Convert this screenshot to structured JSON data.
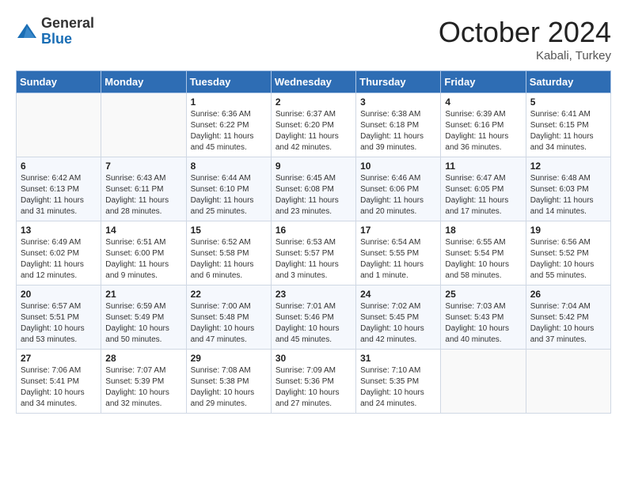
{
  "header": {
    "logo_line1": "General",
    "logo_line2": "Blue",
    "month_title": "October 2024",
    "location": "Kabali, Turkey"
  },
  "days_of_week": [
    "Sunday",
    "Monday",
    "Tuesday",
    "Wednesday",
    "Thursday",
    "Friday",
    "Saturday"
  ],
  "weeks": [
    [
      {
        "day": "",
        "content": ""
      },
      {
        "day": "",
        "content": ""
      },
      {
        "day": "1",
        "content": "Sunrise: 6:36 AM\nSunset: 6:22 PM\nDaylight: 11 hours and 45 minutes."
      },
      {
        "day": "2",
        "content": "Sunrise: 6:37 AM\nSunset: 6:20 PM\nDaylight: 11 hours and 42 minutes."
      },
      {
        "day": "3",
        "content": "Sunrise: 6:38 AM\nSunset: 6:18 PM\nDaylight: 11 hours and 39 minutes."
      },
      {
        "day": "4",
        "content": "Sunrise: 6:39 AM\nSunset: 6:16 PM\nDaylight: 11 hours and 36 minutes."
      },
      {
        "day": "5",
        "content": "Sunrise: 6:41 AM\nSunset: 6:15 PM\nDaylight: 11 hours and 34 minutes."
      }
    ],
    [
      {
        "day": "6",
        "content": "Sunrise: 6:42 AM\nSunset: 6:13 PM\nDaylight: 11 hours and 31 minutes."
      },
      {
        "day": "7",
        "content": "Sunrise: 6:43 AM\nSunset: 6:11 PM\nDaylight: 11 hours and 28 minutes."
      },
      {
        "day": "8",
        "content": "Sunrise: 6:44 AM\nSunset: 6:10 PM\nDaylight: 11 hours and 25 minutes."
      },
      {
        "day": "9",
        "content": "Sunrise: 6:45 AM\nSunset: 6:08 PM\nDaylight: 11 hours and 23 minutes."
      },
      {
        "day": "10",
        "content": "Sunrise: 6:46 AM\nSunset: 6:06 PM\nDaylight: 11 hours and 20 minutes."
      },
      {
        "day": "11",
        "content": "Sunrise: 6:47 AM\nSunset: 6:05 PM\nDaylight: 11 hours and 17 minutes."
      },
      {
        "day": "12",
        "content": "Sunrise: 6:48 AM\nSunset: 6:03 PM\nDaylight: 11 hours and 14 minutes."
      }
    ],
    [
      {
        "day": "13",
        "content": "Sunrise: 6:49 AM\nSunset: 6:02 PM\nDaylight: 11 hours and 12 minutes."
      },
      {
        "day": "14",
        "content": "Sunrise: 6:51 AM\nSunset: 6:00 PM\nDaylight: 11 hours and 9 minutes."
      },
      {
        "day": "15",
        "content": "Sunrise: 6:52 AM\nSunset: 5:58 PM\nDaylight: 11 hours and 6 minutes."
      },
      {
        "day": "16",
        "content": "Sunrise: 6:53 AM\nSunset: 5:57 PM\nDaylight: 11 hours and 3 minutes."
      },
      {
        "day": "17",
        "content": "Sunrise: 6:54 AM\nSunset: 5:55 PM\nDaylight: 11 hours and 1 minute."
      },
      {
        "day": "18",
        "content": "Sunrise: 6:55 AM\nSunset: 5:54 PM\nDaylight: 10 hours and 58 minutes."
      },
      {
        "day": "19",
        "content": "Sunrise: 6:56 AM\nSunset: 5:52 PM\nDaylight: 10 hours and 55 minutes."
      }
    ],
    [
      {
        "day": "20",
        "content": "Sunrise: 6:57 AM\nSunset: 5:51 PM\nDaylight: 10 hours and 53 minutes."
      },
      {
        "day": "21",
        "content": "Sunrise: 6:59 AM\nSunset: 5:49 PM\nDaylight: 10 hours and 50 minutes."
      },
      {
        "day": "22",
        "content": "Sunrise: 7:00 AM\nSunset: 5:48 PM\nDaylight: 10 hours and 47 minutes."
      },
      {
        "day": "23",
        "content": "Sunrise: 7:01 AM\nSunset: 5:46 PM\nDaylight: 10 hours and 45 minutes."
      },
      {
        "day": "24",
        "content": "Sunrise: 7:02 AM\nSunset: 5:45 PM\nDaylight: 10 hours and 42 minutes."
      },
      {
        "day": "25",
        "content": "Sunrise: 7:03 AM\nSunset: 5:43 PM\nDaylight: 10 hours and 40 minutes."
      },
      {
        "day": "26",
        "content": "Sunrise: 7:04 AM\nSunset: 5:42 PM\nDaylight: 10 hours and 37 minutes."
      }
    ],
    [
      {
        "day": "27",
        "content": "Sunrise: 7:06 AM\nSunset: 5:41 PM\nDaylight: 10 hours and 34 minutes."
      },
      {
        "day": "28",
        "content": "Sunrise: 7:07 AM\nSunset: 5:39 PM\nDaylight: 10 hours and 32 minutes."
      },
      {
        "day": "29",
        "content": "Sunrise: 7:08 AM\nSunset: 5:38 PM\nDaylight: 10 hours and 29 minutes."
      },
      {
        "day": "30",
        "content": "Sunrise: 7:09 AM\nSunset: 5:36 PM\nDaylight: 10 hours and 27 minutes."
      },
      {
        "day": "31",
        "content": "Sunrise: 7:10 AM\nSunset: 5:35 PM\nDaylight: 10 hours and 24 minutes."
      },
      {
        "day": "",
        "content": ""
      },
      {
        "day": "",
        "content": ""
      }
    ]
  ]
}
